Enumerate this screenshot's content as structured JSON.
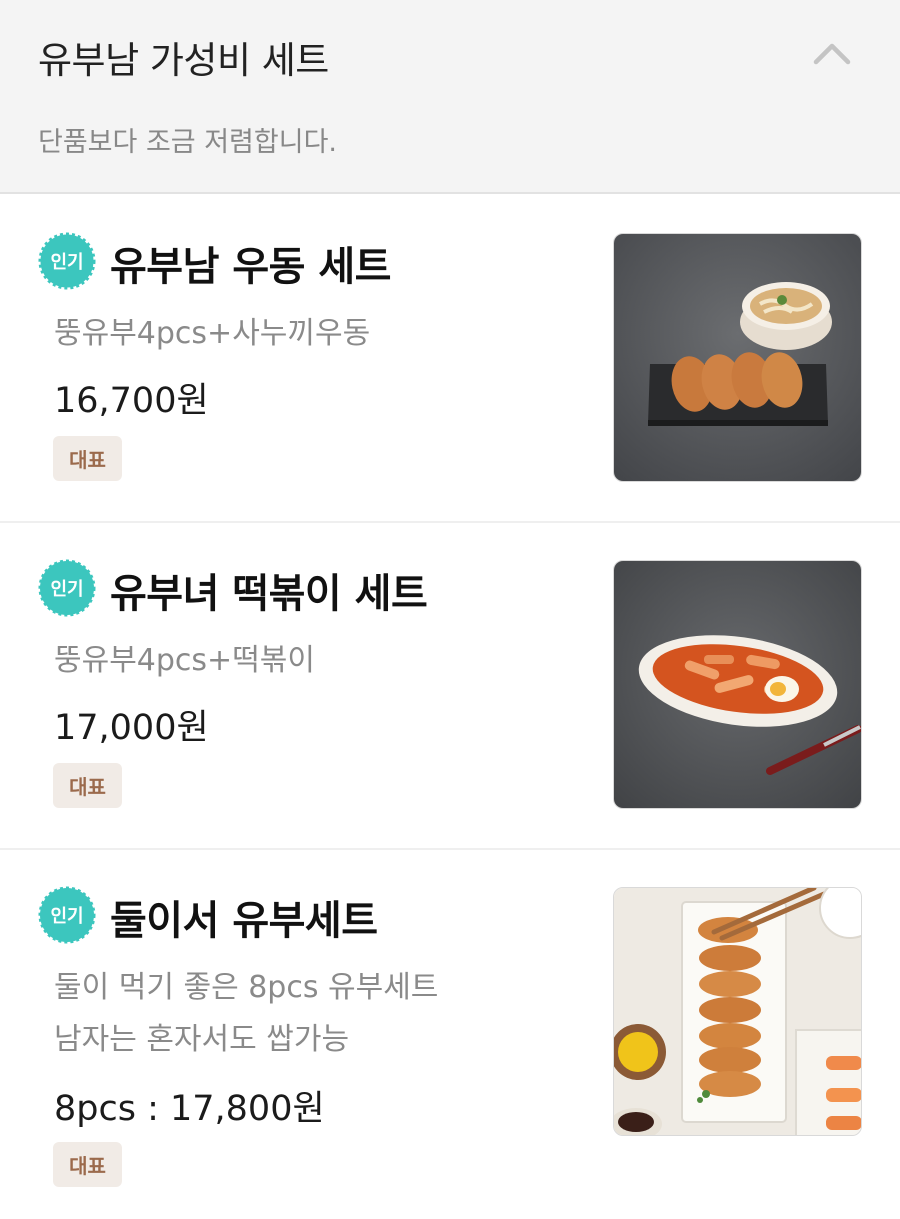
{
  "section": {
    "title": "유부남 가성비 세트",
    "subtitle": "단품보다 조금 저렴합니다."
  },
  "items": [
    {
      "badge": "인기",
      "name": "유부남 우동 세트",
      "desc": [
        "뚱유부4pcs+사누끼우동"
      ],
      "price": "16,700원",
      "tag": "대표"
    },
    {
      "badge": "인기",
      "name": "유부녀 떡볶이 세트",
      "desc": [
        "뚱유부4pcs+떡볶이"
      ],
      "price": "17,000원",
      "tag": "대표"
    },
    {
      "badge": "인기",
      "name": "둘이서 유부세트",
      "desc": [
        "둘이 먹기 좋은 8pcs 유부세트",
        "남자는 혼자서도 쌉가능"
      ],
      "price": "8pcs : 17,800원",
      "tag": "대표"
    }
  ],
  "colors": {
    "badge": "#3cc6be",
    "tag_bg": "#f1ebe6",
    "tag_text": "#9b6a4c",
    "header_bg": "#f4f4f4"
  },
  "icons": {
    "collapse": "chevron-up-icon"
  }
}
